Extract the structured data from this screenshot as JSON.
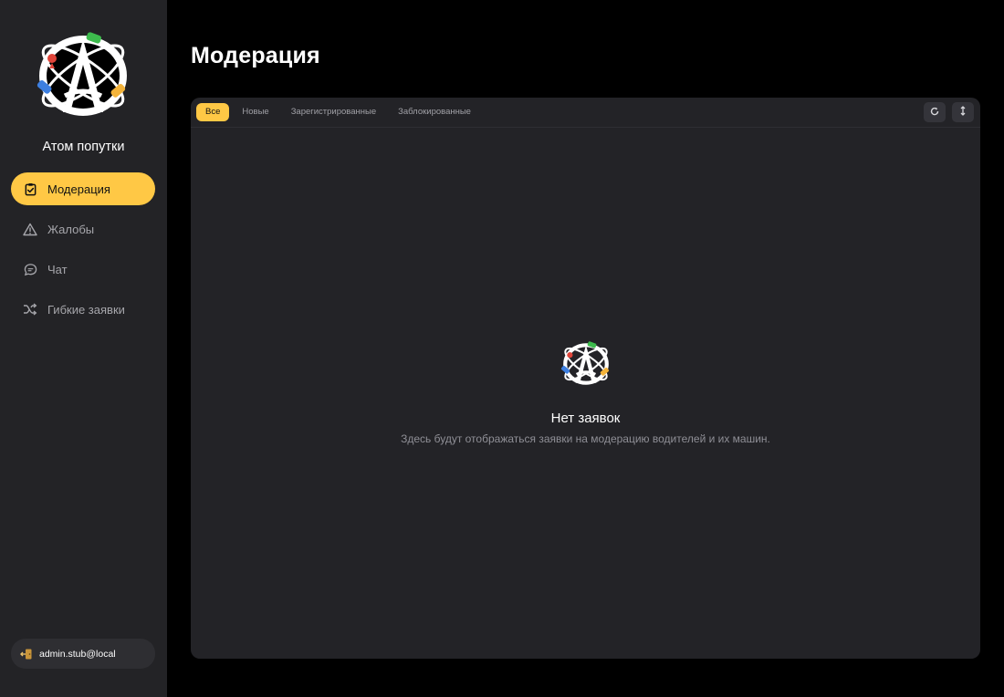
{
  "sidebar": {
    "brand": "Атом попутки",
    "items": [
      {
        "label": "Модерация",
        "icon": "clipboard-check-icon",
        "active": true
      },
      {
        "label": "Жалобы",
        "icon": "warning-triangle-icon",
        "active": false
      },
      {
        "label": "Чат",
        "icon": "chat-bubble-icon",
        "active": false
      },
      {
        "label": "Гибкие заявки",
        "icon": "shuffle-icon",
        "active": false
      }
    ],
    "user": {
      "email": "admin.stub@local",
      "icon": "logout-icon"
    }
  },
  "main": {
    "title": "Модерация",
    "tabs": [
      {
        "label": "Все",
        "active": true
      },
      {
        "label": "Новые",
        "active": false
      },
      {
        "label": "Зарегистрированные",
        "active": false
      },
      {
        "label": "Заблокированные",
        "active": false
      }
    ],
    "tools": {
      "refresh_icon": "refresh-icon",
      "sort_icon": "sort-icon"
    },
    "empty": {
      "title": "Нет заявок",
      "description": "Здесь будут отображаться заявки на модерацию водителей и их машин."
    }
  },
  "colors": {
    "accent": "#ffc845",
    "sidebar_bg": "#232326",
    "panel_bg": "#232327",
    "page_bg": "#000000"
  }
}
